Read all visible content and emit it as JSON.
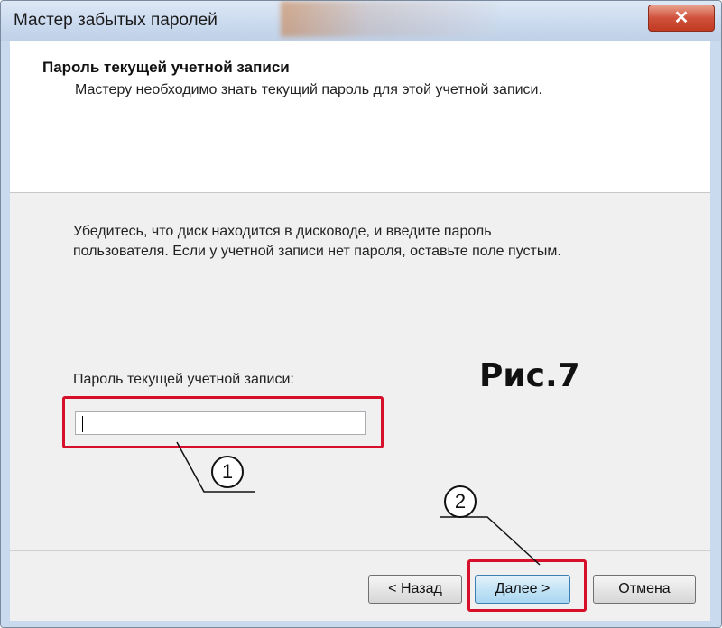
{
  "window": {
    "title": "Мастер забытых паролей",
    "close_label": "✕"
  },
  "header": {
    "title": "Пароль текущей учетной записи",
    "subtitle": "Мастеру необходимо знать текущий пароль для этой учетной записи."
  },
  "body": {
    "instructions": "Убедитесь, что диск находится в дисководе, и введите пароль пользователя. Если у учетной записи нет пароля, оставьте поле пустым.",
    "password_label": "Пароль текущей учетной записи:",
    "password_value": ""
  },
  "annotation": {
    "figure_label": "Рис.7",
    "callout_1": "1",
    "callout_2": "2",
    "highlight_color": "#d6102a"
  },
  "footer": {
    "back_label": "< Назад",
    "next_label": "Далее >",
    "cancel_label": "Отмена"
  }
}
